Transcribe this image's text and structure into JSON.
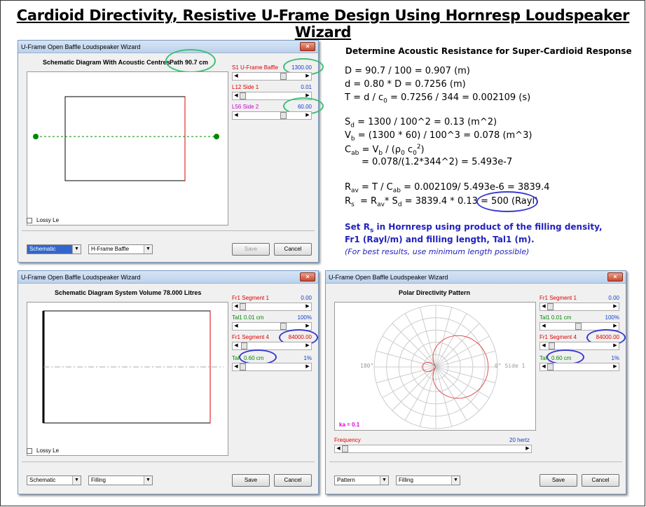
{
  "page_title": "Cardioid Directivity, Resistive U-Frame Design Using Hornresp Loudspeaker Wizard",
  "window_title": "U-Frame Open Baffle Loudspeaker Wizard",
  "close_glyph": "×",
  "lossy_label": "Lossy Le",
  "save_label": "Save",
  "cancel_label": "Cancel",
  "win1": {
    "caption": "Schematic Diagram With Acoustic Centres",
    "path": "Path 90.7 cm",
    "s1_label": "S1  U-Frame Baffle",
    "s1_value": "1300.00",
    "l12_label": "L12  Side 1",
    "l12_value": "0.01",
    "l56_label": "L56  Side 2",
    "l56_value": "60.00",
    "select1": "Schematic",
    "select2": "H-Frame Baffle"
  },
  "win2": {
    "caption": "Schematic Diagram   System Volume 78.000 Litres",
    "fr1_seg1_label": "Fr1  Segment 1",
    "fr1_seg1_value": "0.00",
    "tal1_label": "Tal1  0.01 cm",
    "tal1_value": "100%",
    "fr1_seg4_label": "Fr1  Segment 4",
    "fr1_seg4_value": "84000.00",
    "tal4_prefix": "Tal",
    "tal4_label": "0.60 cm",
    "tal4_value": "1%",
    "select1": "Schematic",
    "select2": "Filling"
  },
  "win3": {
    "caption": "Polar Directivity Pattern",
    "angle_180": "180°",
    "angle_0": "0° Side 1",
    "ka": "ka = 0.1",
    "freq_label": "Frequency",
    "freq_value": "20 hertz",
    "select1": "Pattern",
    "select2": "Filling"
  },
  "equations": {
    "heading": "Determine Acoustic Resistance for Super-Cardioid Response",
    "D": "D = 90.7 / 100 = 0.907 (m)",
    "d": "d  = 0.80 * D = 0.7256 (m)",
    "T_pre": "T  =  d / c",
    "T_sub": "0",
    "T_post": " = 0.7256 / 344 = 0.002109 (s)",
    "Sd_pre": "S",
    "Sd_sub": "d",
    "Sd_post": " = 1300 / 100^2 = 0.13 (m^2)",
    "Vb_pre": "V",
    "Vb_sub": "b",
    "Vb_post": " = (1300 * 60) / 100^3 = 0.078 (m^3)",
    "Cab_line": "C",
    "Cab_line2": "= 0.078/(1.2*344^2) = 5.493e-7",
    "Rav_line": "R",
    "Rs_pre": "R",
    "Rs_value": "500 (Rayl)",
    "note_line1": "Set R",
    "note_line1_post": " in Hornresp using product of the  filling density,",
    "note_line2": "Fr1 (Rayl/m) and filling length, Tal1 (m).",
    "note_line3": "(For best results, use minimum length possible)"
  }
}
